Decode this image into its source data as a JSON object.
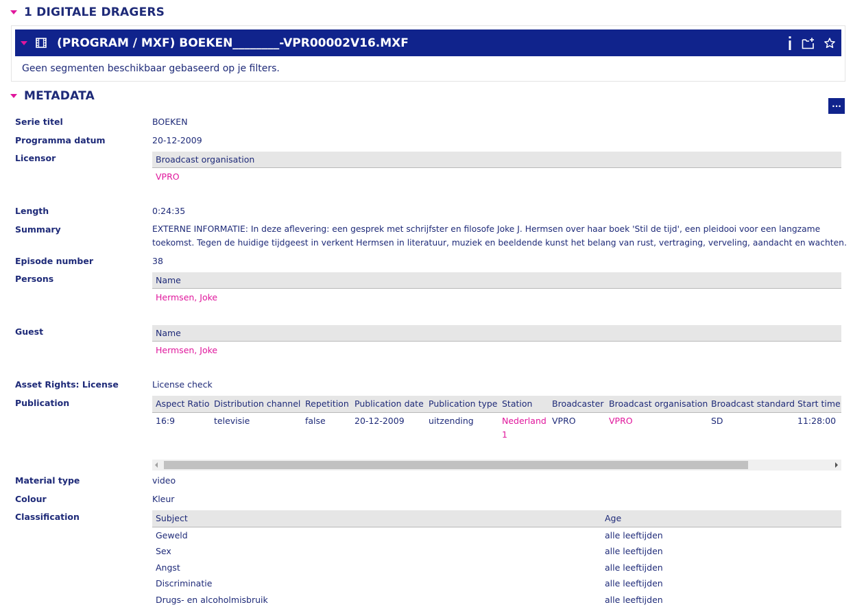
{
  "carriers": {
    "title": "1 DIGITALE DRAGERS",
    "file_title": "(PROGRAM / MXF) BOEKEN________-VPR00002V16.MXF",
    "empty_message": "Geen segmenten beschikbaar gebaseerd op je filters."
  },
  "metadata": {
    "title": "METADATA",
    "more_button": "···",
    "serie_titel": {
      "label": "Serie titel",
      "value": "BOEKEN"
    },
    "programma_datum": {
      "label": "Programma datum",
      "value": "20-12-2009"
    },
    "licensor": {
      "label": "Licensor",
      "header": "Broadcast organisation",
      "value": "VPRO"
    },
    "length": {
      "label": "Length",
      "value": "0:24:35"
    },
    "summary": {
      "label": "Summary",
      "line1": "EXTERNE INFORMATIE: In deze aflevering: een gesprek met schrijfster en filosofe Joke J. Hermsen over haar boek 'Stil de tijd', een pleidooi voor een langzame",
      "line2": "toekomst. Tegen de huidige tijdgeest in verkent Hermsen in literatuur, muziek en beeldende kunst het belang van rust, vertraging, verveling, aandacht en wachten."
    },
    "episode_number": {
      "label": "Episode number",
      "value": "38"
    },
    "persons": {
      "label": "Persons",
      "header": "Name",
      "value": "Hermsen, Joke"
    },
    "guest": {
      "label": "Guest",
      "header": "Name",
      "value": "Hermsen, Joke"
    },
    "asset_rights": {
      "label": "Asset Rights: License",
      "value": "License check"
    },
    "publication": {
      "label": "Publication",
      "headers": [
        "Aspect Ratio",
        "Distribution channel",
        "Repetition",
        "Publication date",
        "Publication type",
        "Station",
        "Broadcaster",
        "Broadcast organisation",
        "Broadcast standard",
        "Start time"
      ],
      "row": {
        "aspect_ratio": "16:9",
        "channel": "televisie",
        "repetition": "false",
        "date": "20-12-2009",
        "type": "uitzending",
        "station_line1": "Nederland",
        "station_line2": "1",
        "broadcaster": "VPRO",
        "organisation": "VPRO",
        "standard": "SD",
        "start_time": "11:28:00"
      },
      "scrollbar_position": 0.0
    },
    "material_type": {
      "label": "Material type",
      "value": "video"
    },
    "colour": {
      "label": "Colour",
      "value": "Kleur"
    },
    "classification": {
      "label": "Classification",
      "subject_header": "Subject",
      "age_header": "Age",
      "rows": [
        {
          "subject": "Geweld",
          "age": "alle leeftijden"
        },
        {
          "subject": "Sex",
          "age": "alle leeftijden"
        },
        {
          "subject": "Angst",
          "age": "alle leeftijden"
        },
        {
          "subject": "Discriminatie",
          "age": "alle leeftijden"
        },
        {
          "subject": "Drugs- en alcoholmisbruik",
          "age": "alle leeftijden"
        }
      ]
    }
  },
  "icons": {
    "collapse": "triangle-down-icon",
    "film": "film-icon",
    "info": "info-icon",
    "add_folder": "add-to-folder-icon",
    "favorite": "star-icon"
  },
  "colors": {
    "brand_blue": "#10238c",
    "accent_pink": "#e0169c",
    "text": "#1e2a78"
  }
}
